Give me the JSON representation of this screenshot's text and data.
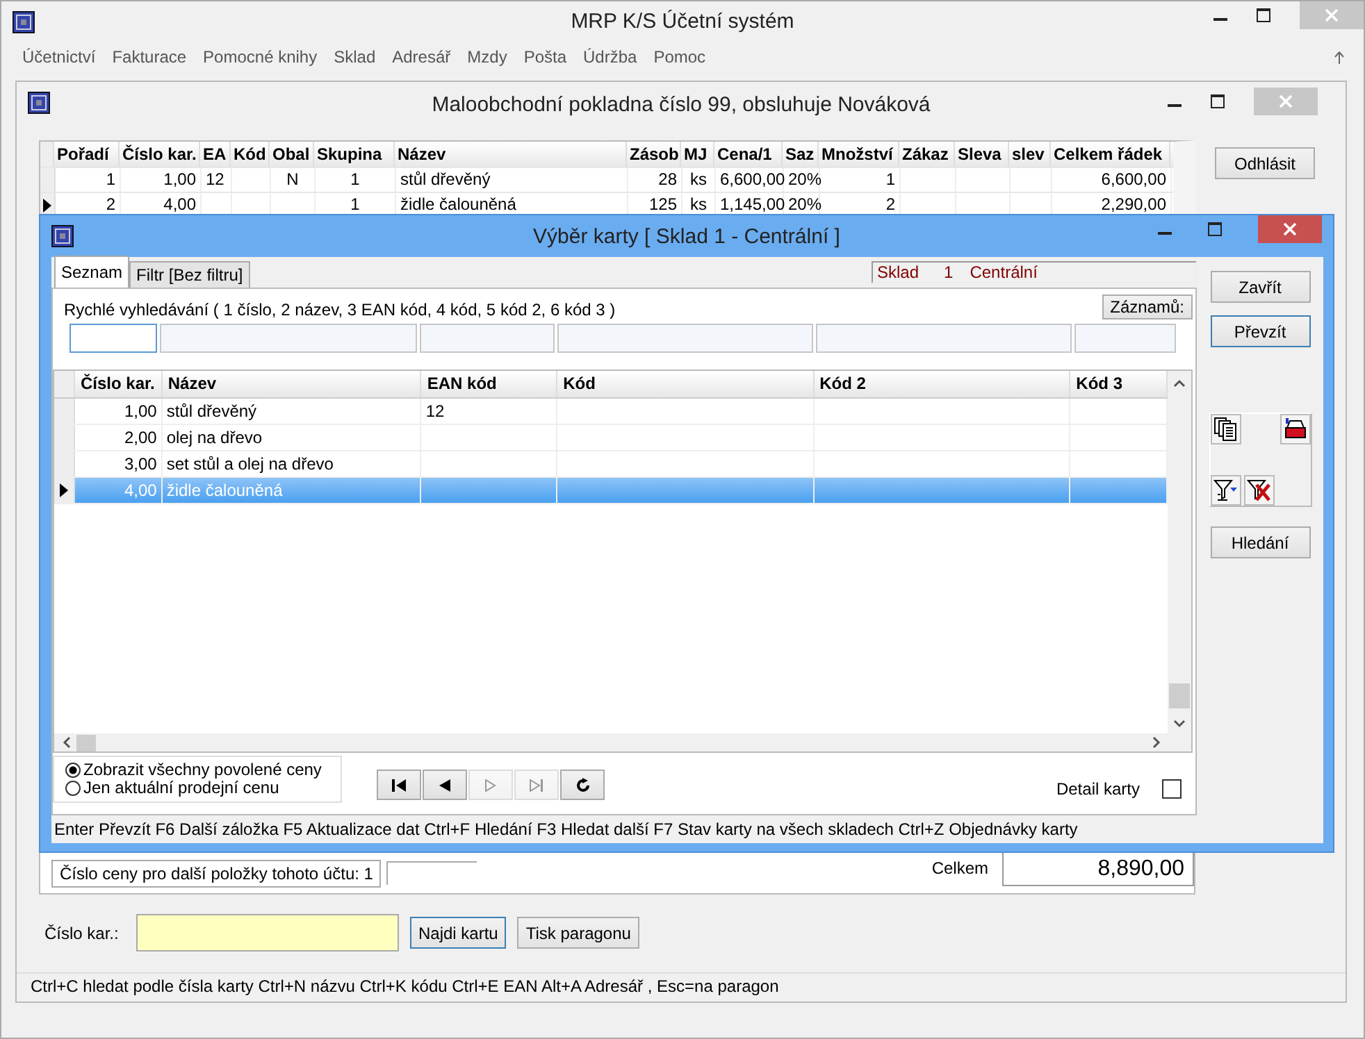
{
  "app_window": {
    "title": "MRP K/S Účetní systém"
  },
  "menu": [
    "Účetnictví",
    "Fakturace",
    "Pomocné knihy",
    "Sklad",
    "Adresář",
    "Mzdy",
    "Pošta",
    "Údržba",
    "Pomoc"
  ],
  "pos_window": {
    "title": "Maloobchodní pokladna číslo 99, obsluhuje Nováková",
    "receipt_table": {
      "columns": [
        "Pořadí",
        "Číslo kar.",
        "EA",
        "Kód",
        "Obal",
        "Skupina",
        "Název",
        "Zásob",
        "MJ",
        "Cena/1",
        "Saz",
        "Množství",
        "Zákaz",
        "Sleva",
        "slev",
        "Celkem řádek"
      ],
      "rows": [
        {
          "selected": false,
          "cells": [
            "1",
            "1,00",
            "12",
            null,
            "N",
            "1",
            "stůl dřevěný",
            "28",
            "ks",
            "6,600,00",
            "20%",
            "1",
            null,
            null,
            null,
            "6,600,00"
          ]
        },
        {
          "selected": true,
          "cells": [
            "2",
            "4,00",
            null,
            null,
            null,
            "1",
            "židle  čalouněná",
            "125",
            "ks",
            "1,145,00",
            "20%",
            "2",
            null,
            null,
            null,
            "2,290,00"
          ]
        }
      ]
    },
    "logout_button": "Odhlásit",
    "price_number_label": "Číslo ceny pro další položky tohoto účtu: 1",
    "total_label": "Celkem",
    "total_value": "8,890,00",
    "card_number_label": "Číslo kar.:",
    "find_card_button": "Najdi kartu",
    "print_receipt_button": "Tisk paragonu",
    "status_bar": "Ctrl+C hledat podle čísla karty  Ctrl+N názvu  Ctrl+K kódu  Ctrl+E EAN  Alt+A Adresář  , Esc=na paragon"
  },
  "card_dialog": {
    "title": "Výběr karty [ Sklad 1 - Centrální ]",
    "tabs": [
      {
        "label": "Seznam",
        "selected": true
      },
      {
        "label": "Filtr [Bez filtru]",
        "selected": false
      }
    ],
    "warehouse": {
      "label": "Sklad",
      "number": "1",
      "name": "Centrální"
    },
    "quick_search_label": "Rychlé vyhledávání ( 1 číslo, 2 název, 3 EAN kód, 4 kód, 5 kód 2, 6 kód 3 )",
    "records_button": "Záznamů:",
    "card_table": {
      "columns": [
        "Číslo kar.",
        "Název",
        "EAN kód",
        "Kód",
        "Kód 2",
        "Kód 3"
      ],
      "rows": [
        {
          "selected": false,
          "cells": [
            "1,00",
            "stůl dřevěný",
            "12",
            null,
            null,
            null
          ]
        },
        {
          "selected": false,
          "cells": [
            "2,00",
            "olej na dřevo",
            null,
            null,
            null,
            null
          ]
        },
        {
          "selected": false,
          "cells": [
            "3,00",
            "set stůl a olej na dřevo",
            null,
            null,
            null,
            null
          ]
        },
        {
          "selected": true,
          "cells": [
            "4,00",
            "židle  čalouněná",
            null,
            null,
            null,
            null
          ]
        }
      ]
    },
    "price_options": [
      {
        "label": "Zobrazit všechny povolené ceny",
        "selected": true
      },
      {
        "label": "Jen aktuální prodejní cenu",
        "selected": false
      }
    ],
    "nav_buttons": [
      {
        "kind": "first",
        "disabled": false
      },
      {
        "kind": "prev",
        "disabled": false
      },
      {
        "kind": "next",
        "disabled": true
      },
      {
        "kind": "last",
        "disabled": true
      },
      {
        "kind": "refresh",
        "disabled": false
      }
    ],
    "detail_checkbox": {
      "label": "Detail karty",
      "checked": false
    },
    "buttons": [
      "Zavřít",
      "Převzít",
      "Hledání"
    ],
    "status_bar": "Enter Převzít  F6 Další záložka  F5 Aktualizace dat  Ctrl+F Hledání  F3 Hledat další  F7 Stav karty na všech skladech  Ctrl+Z Objednávky karty"
  }
}
